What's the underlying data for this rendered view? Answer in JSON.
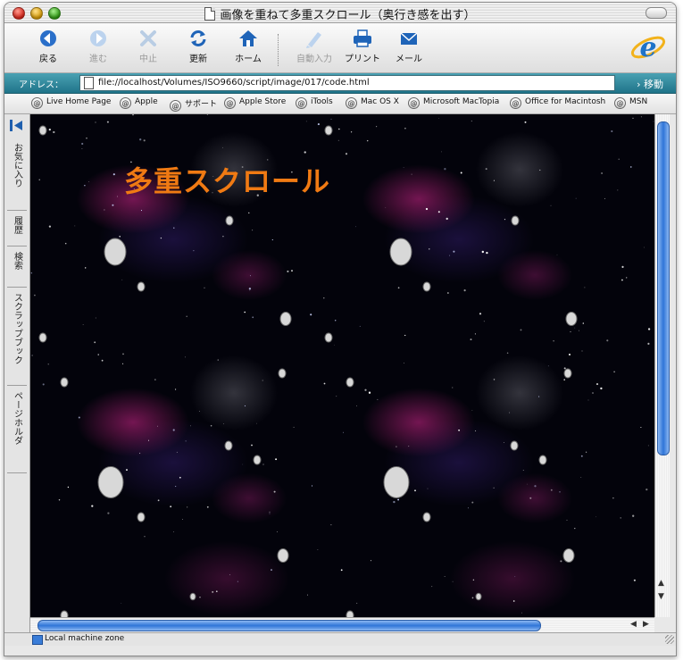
{
  "window": {
    "title": "画像を重ねて多重スクロール（奥行き感を出す）"
  },
  "toolbar": {
    "buttons": [
      {
        "label": "戻る",
        "icon": "back-arrow-icon",
        "enabled": true
      },
      {
        "label": "進む",
        "icon": "forward-arrow-icon",
        "enabled": false
      },
      {
        "label": "中止",
        "icon": "stop-icon",
        "enabled": false
      },
      {
        "label": "更新",
        "icon": "refresh-icon",
        "enabled": true
      },
      {
        "label": "ホーム",
        "icon": "home-icon",
        "enabled": true
      },
      {
        "label": "自動入力",
        "icon": "autofill-icon",
        "enabled": false
      },
      {
        "label": "プリント",
        "icon": "print-icon",
        "enabled": true
      },
      {
        "label": "メール",
        "icon": "mail-icon",
        "enabled": true
      }
    ]
  },
  "address": {
    "label": "アドレス：",
    "url": "file://localhost/Volumes/ISO9660/script/image/017/code.html",
    "go_label": "移動"
  },
  "favorites": [
    "Live Home Page",
    "Apple",
    "サポート",
    "Apple Store",
    "iTools",
    "Mac OS X",
    "Microsoft MacTopia",
    "Office for Macintosh",
    "MSN"
  ],
  "sidebar": {
    "tabs": [
      "お気に入り",
      "履歴",
      "検索",
      "スクラップブック",
      "ページホルダ"
    ]
  },
  "page": {
    "heading": "多重スクロール"
  },
  "status": {
    "zone": "Local machine zone"
  },
  "colors": {
    "heading": "#f07a13",
    "address_bar": "#2a8196",
    "scroll_thumb": "#2f75d8",
    "space_background": "#03030b"
  }
}
